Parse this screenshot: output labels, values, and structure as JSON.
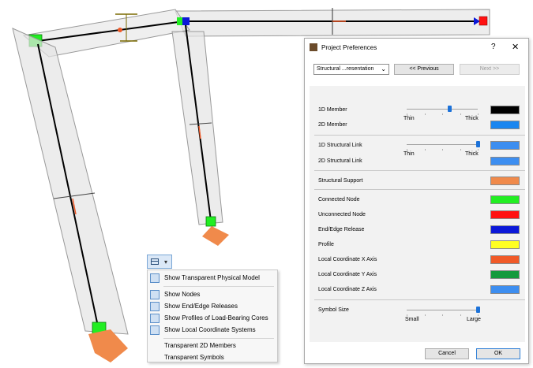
{
  "toolbar": {
    "dropdown_arrow": "▾"
  },
  "menu": {
    "items": [
      {
        "label": "Show Transparent Physical Model",
        "icon": "transparent-model-icon",
        "checked": true
      },
      {
        "label": "Show Nodes",
        "icon": "nodes-icon",
        "checked": true
      },
      {
        "label": "Show End/Edge Releases",
        "icon": "releases-icon",
        "checked": true
      },
      {
        "label": "Show Profiles of Load-Bearing Cores",
        "icon": "profiles-icon",
        "checked": true
      },
      {
        "label": "Show Local Coordinate Systems",
        "icon": "coordinate-systems-icon",
        "checked": true
      },
      {
        "label": "Transparent 2D Members",
        "icon": "transparent-2d-icon",
        "checked": false
      },
      {
        "label": "Transparent Symbols",
        "icon": "transparent-symbols-icon",
        "checked": false
      }
    ]
  },
  "dialog": {
    "title": "Project Preferences",
    "help": "?",
    "close": "✕",
    "page_select": "Structural ...resentation",
    "prev_label": "<< Previous",
    "next_label": "Next >>",
    "cancel_label": "Cancel",
    "ok_label": "OK",
    "member_thickness": {
      "min_label": "Thin",
      "max_label": "Thick",
      "value": 0.6
    },
    "link_thickness": {
      "min_label": "Thin",
      "max_label": "Thick",
      "value": 1.0
    },
    "symbol_size": {
      "label": "Symbol Size",
      "min_label": "Small",
      "max_label": "Large",
      "value": 1.0
    },
    "rows": [
      {
        "label": "1D Member",
        "color": "#000000"
      },
      {
        "label": "2D Member",
        "color": "#1a86f0"
      },
      {
        "label": "1D Structural Link",
        "color": "#3d8ef0"
      },
      {
        "label": "2D Structural Link",
        "color": "#3d8ef0"
      },
      {
        "label": "Structural Support",
        "color": "#f08a4b"
      },
      {
        "label": "Connected Node",
        "color": "#22ee22"
      },
      {
        "label": "Unconnected Node",
        "color": "#ff1111"
      },
      {
        "label": "End/Edge Release",
        "color": "#0b18d8"
      },
      {
        "label": "Profile",
        "color": "#ffff22"
      },
      {
        "label": "Local Coordinate X Axis",
        "color": "#f05a28"
      },
      {
        "label": "Local Coordinate Y Axis",
        "color": "#159a3e"
      },
      {
        "label": "Local Coordinate Z Axis",
        "color": "#3d8ef0"
      }
    ]
  }
}
